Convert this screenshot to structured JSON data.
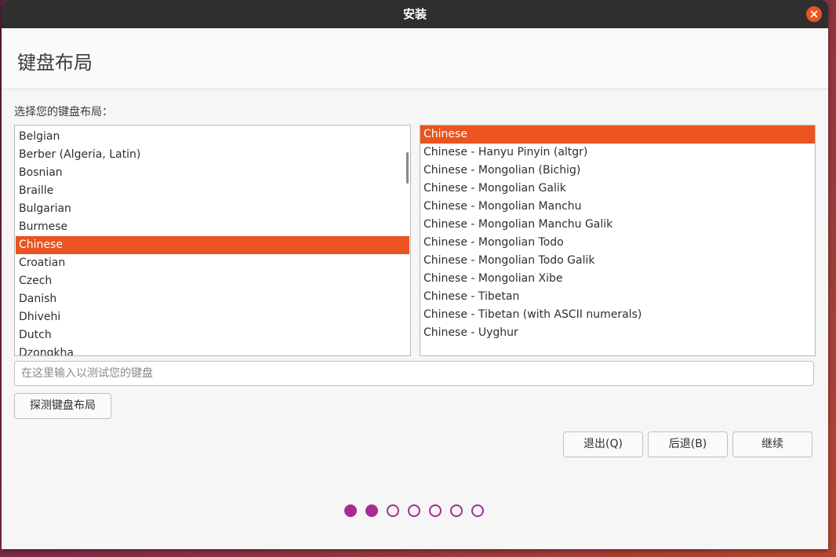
{
  "window": {
    "title": "安装"
  },
  "page": {
    "title": "键盘布局",
    "prompt": "选择您的键盘布局："
  },
  "layouts": {
    "items": [
      "Belgian",
      "Berber (Algeria, Latin)",
      "Bosnian",
      "Braille",
      "Bulgarian",
      "Burmese",
      "Chinese",
      "Croatian",
      "Czech",
      "Danish",
      "Dhivehi",
      "Dutch",
      "Dzongkha"
    ],
    "selected": "Chinese"
  },
  "variants": {
    "items": [
      "Chinese",
      "Chinese - Hanyu Pinyin (altgr)",
      "Chinese - Mongolian (Bichig)",
      "Chinese - Mongolian Galik",
      "Chinese - Mongolian Manchu",
      "Chinese - Mongolian Manchu Galik",
      "Chinese - Mongolian Todo",
      "Chinese - Mongolian Todo Galik",
      "Chinese - Mongolian Xibe",
      "Chinese - Tibetan",
      "Chinese - Tibetan (with ASCII numerals)",
      "Chinese - Uyghur"
    ],
    "selected": "Chinese"
  },
  "test_field": {
    "placeholder": "在这里输入以测试您的键盘",
    "value": ""
  },
  "buttons": {
    "detect": "探测键盘布局",
    "quit": "退出(Q)",
    "back": "后退(B)",
    "continue": "继续"
  },
  "progress": {
    "total_steps": 7,
    "completed_steps": 2
  },
  "colors": {
    "accent": "#e95420",
    "progress": "#a62c8f",
    "titlebar": "#2f2f2f"
  },
  "icons": {
    "close": "close-icon"
  }
}
